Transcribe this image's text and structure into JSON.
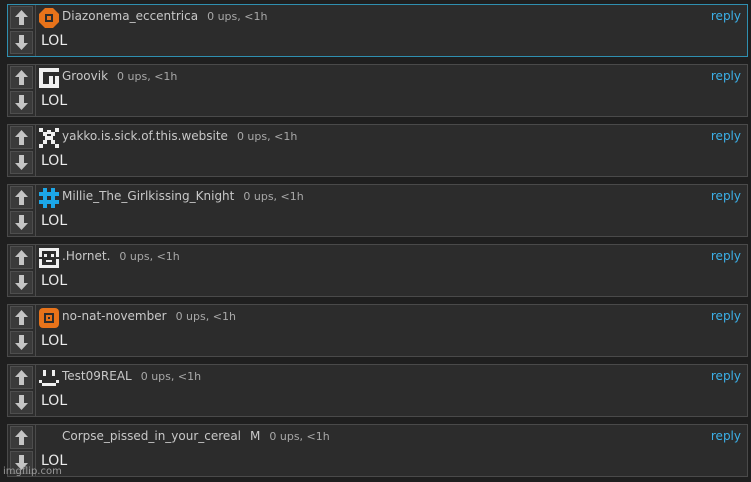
{
  "comments": [
    {
      "username": "Diazonema_eccentrica",
      "badge": "",
      "info": "0 ups, <1h",
      "text": "LOL",
      "reply": "reply",
      "avatar": "orange-octagon-icon",
      "highlighted": true
    },
    {
      "username": "Groovik",
      "badge": "",
      "info": "0 ups, <1h",
      "text": "LOL",
      "reply": "reply",
      "avatar": "white-g-icon",
      "highlighted": false
    },
    {
      "username": "yakko.is.sick.of.this.website",
      "badge": "",
      "info": "0 ups, <1h",
      "text": "LOL",
      "reply": "reply",
      "avatar": "pixel-spider-icon",
      "highlighted": false
    },
    {
      "username": "Millie_The_Girlkissing_Knight",
      "badge": "",
      "info": "0 ups, <1h",
      "text": "LOL",
      "reply": "reply",
      "avatar": "blue-hash-icon",
      "highlighted": false
    },
    {
      "username": ".Hornet.",
      "badge": "",
      "info": "0 ups, <1h",
      "text": "LOL",
      "reply": "reply",
      "avatar": "white-face-icon",
      "highlighted": false
    },
    {
      "username": "no-nat-november",
      "badge": "",
      "info": "0 ups, <1h",
      "text": "LOL",
      "reply": "reply",
      "avatar": "orange-ring-icon",
      "highlighted": false
    },
    {
      "username": "Test09REAL",
      "badge": "",
      "info": "0 ups, <1h",
      "text": "LOL",
      "reply": "reply",
      "avatar": "smile-icon",
      "highlighted": false
    },
    {
      "username": "Corpse_pissed_in_your_cereal",
      "badge": "M",
      "info": "0 ups, <1h",
      "text": "LOL",
      "reply": "reply",
      "avatar": "",
      "highlighted": false
    }
  ],
  "watermark": "imgflip.com",
  "colors": {
    "accent": "#3bb0e8",
    "highlight_border": "#2f8fb0",
    "avatar_orange": "#e8731a",
    "avatar_blue": "#1ca7e8"
  }
}
